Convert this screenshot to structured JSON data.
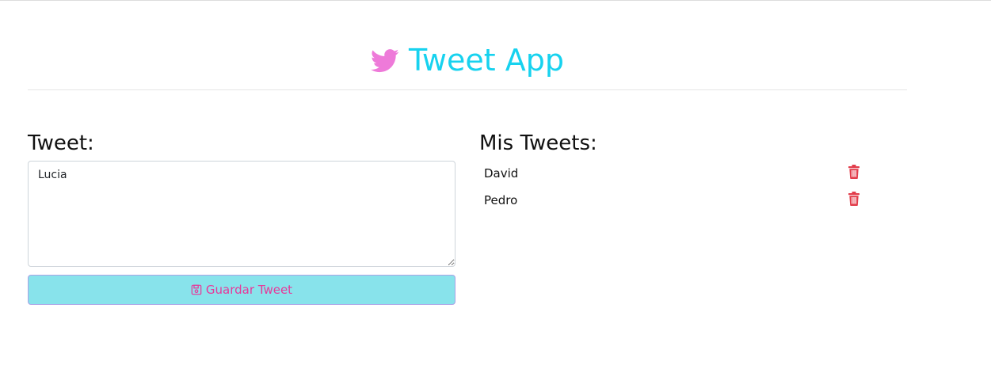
{
  "header": {
    "title": "Tweet App",
    "icon": "twitter-bird-icon",
    "title_color": "#17d2ef",
    "icon_color": "#ee7ad9"
  },
  "form": {
    "heading": "Tweet:",
    "textarea_value": "Lucia",
    "save_label": "Guardar Tweet",
    "save_icon": "floppy-disk-icon",
    "button_bg": "#88e3eb",
    "button_text_color": "#e8389a"
  },
  "tweets": {
    "heading": "Mis Tweets:",
    "delete_icon": "trash-icon",
    "delete_color": "#e23d4b",
    "items": [
      {
        "text": "David"
      },
      {
        "text": "Pedro"
      }
    ]
  }
}
